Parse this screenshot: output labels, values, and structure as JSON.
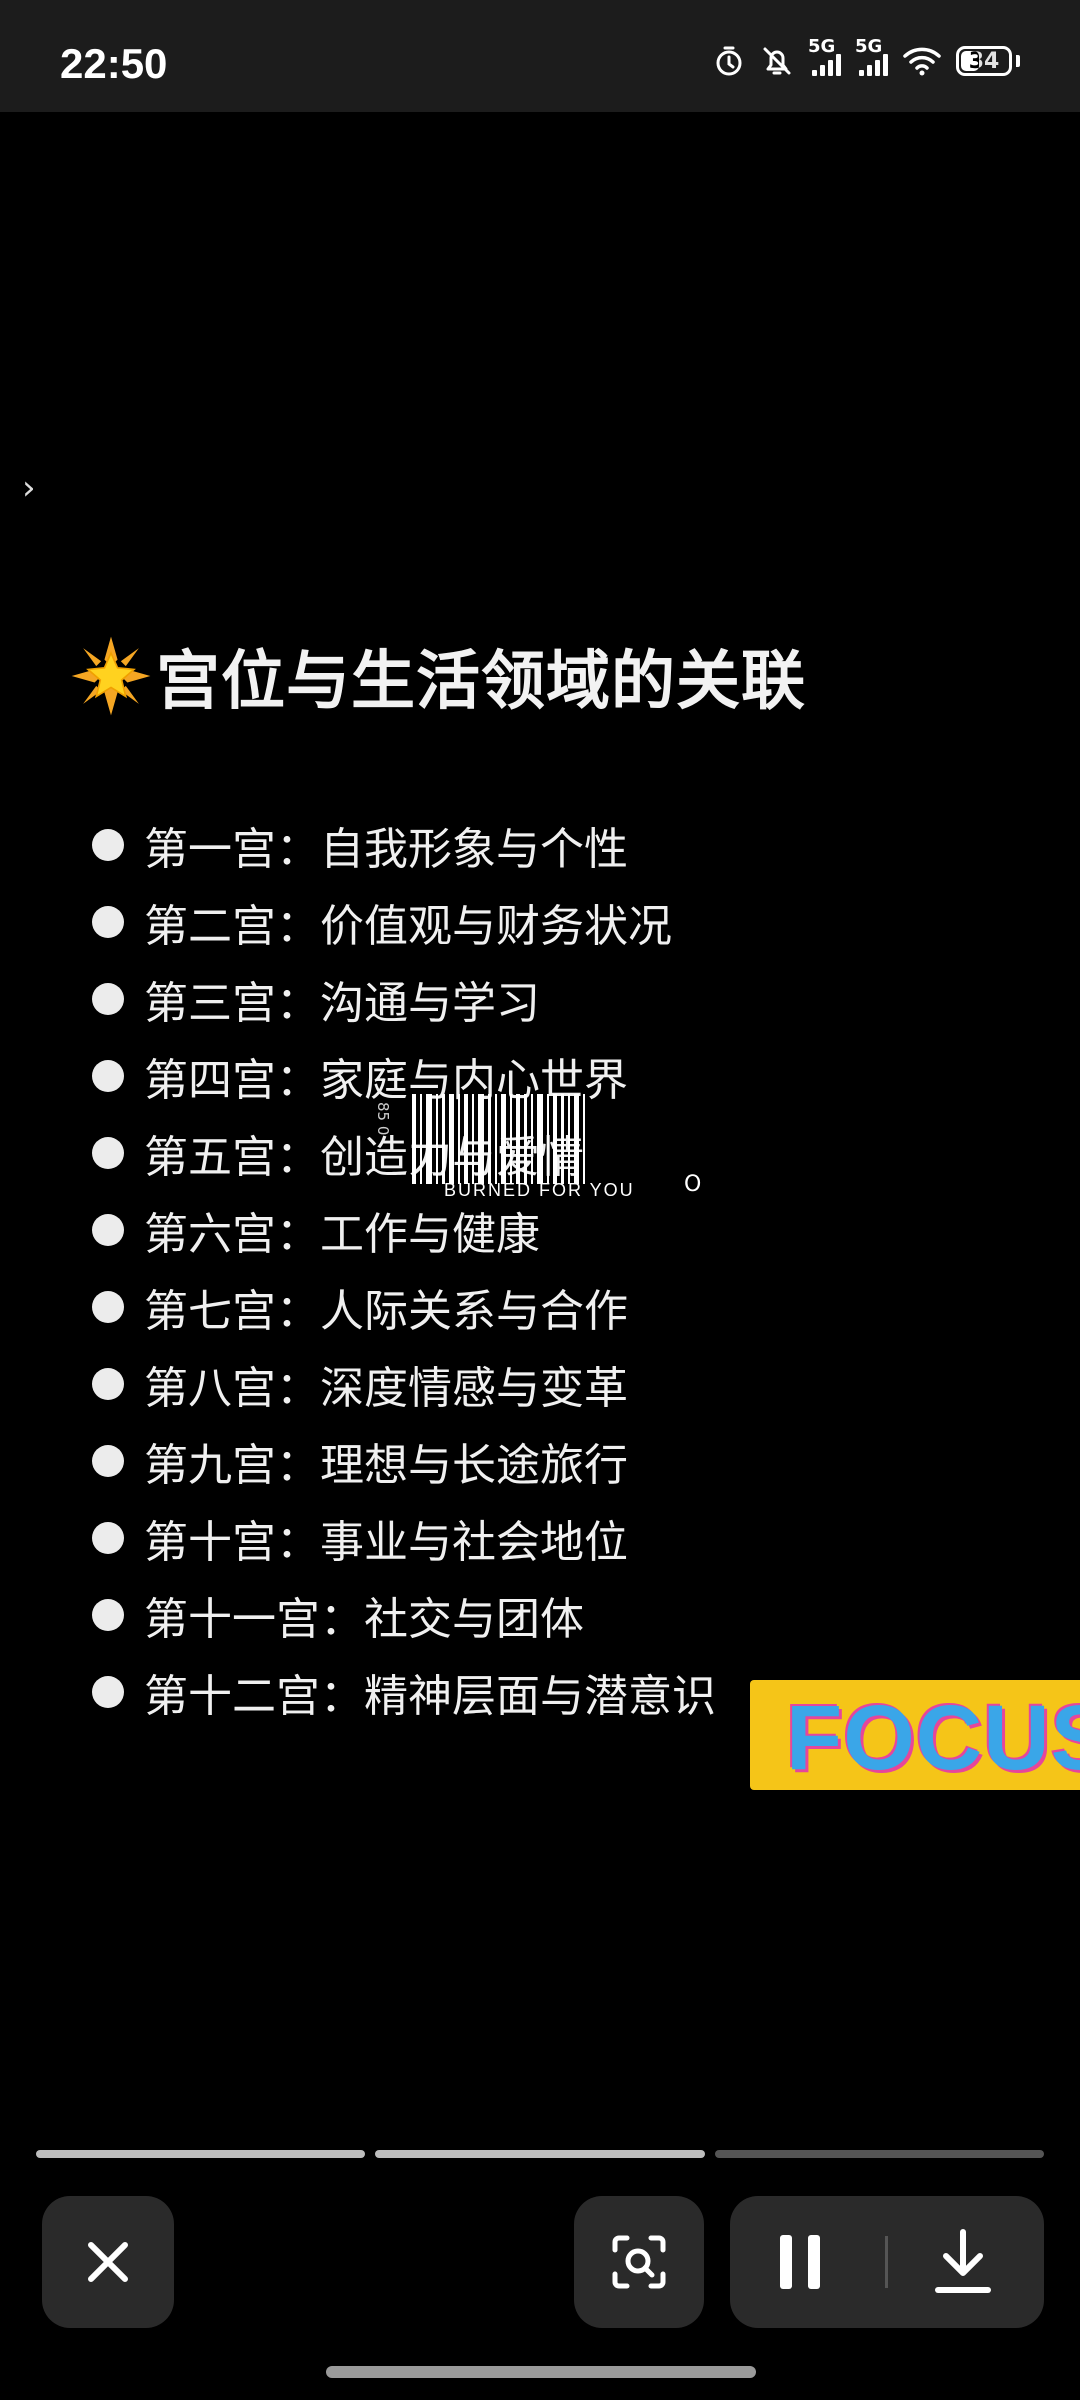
{
  "status_bar": {
    "time": "22:50",
    "icons": [
      "alarm-icon",
      "mute-bell-icon",
      "signal-5g-icon",
      "signal-5g-icon",
      "wifi-icon",
      "battery-icon"
    ],
    "signal_label_1": "5G",
    "signal_label_2": "5G",
    "battery_level": "34"
  },
  "side_arrow": "›",
  "title": {
    "emoji": "glowing-star-icon",
    "text": "宫位与生活领域的关联"
  },
  "houses": [
    {
      "label": "第一宫：自我形象与个性"
    },
    {
      "label": "第二宫：价值观与财务状况"
    },
    {
      "label": "第三宫：沟通与学习"
    },
    {
      "label": "第四宫：家庭与内心世界"
    },
    {
      "label": "第五宫：创造力与爱情"
    },
    {
      "label": "第六宫：工作与健康"
    },
    {
      "label": "第七宫：人际关系与合作"
    },
    {
      "label": "第八宫：深度情感与变革"
    },
    {
      "label": "第九宫：理想与长途旅行"
    },
    {
      "label": "第十宫：事业与社会地位"
    },
    {
      "label": "第十一宫：社交与团体"
    },
    {
      "label": "第十二宫：精神层面与潜意识"
    }
  ],
  "stickers": {
    "barcode_text": "BURNED FOR YOU",
    "barcode_side": "85 0",
    "barcode_mark": "O",
    "focus_text": "FOCUS"
  },
  "progress": {
    "segments": 3,
    "current": 2
  },
  "controls": {
    "close": "close-icon",
    "scan": "lens-scan-icon",
    "pause": "pause-icon",
    "download": "download-icon"
  }
}
